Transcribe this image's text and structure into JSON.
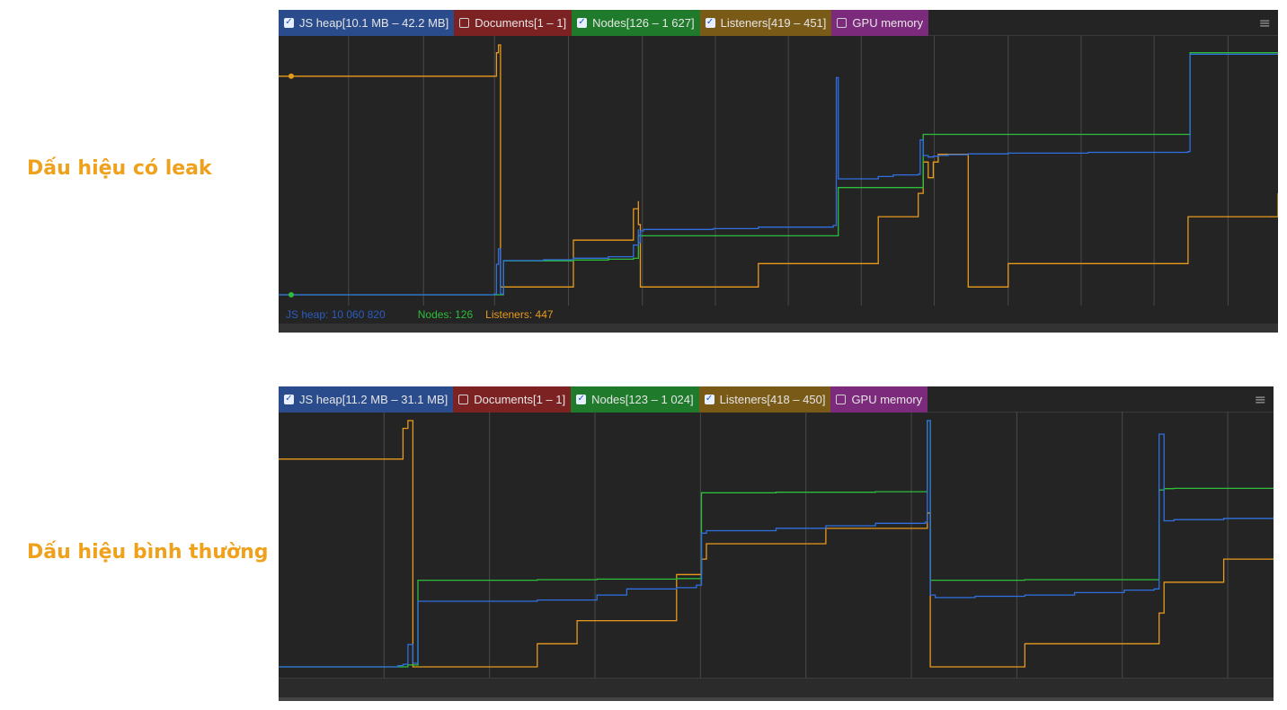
{
  "labels": {
    "leak": "Dấu hiệu có leak",
    "normal": "Dấu hiệu bình thường"
  },
  "colors": {
    "js_heap": "#2f6fe0",
    "nodes": "#2dbd3a",
    "listeners": "#e89a1c",
    "grid": "#4a4a4a",
    "label": "#f0a11c"
  },
  "panels": [
    {
      "legend": {
        "js_heap": "JS heap[10.1 MB – 42.2 MB]",
        "documents": "Documents[1 – 1]",
        "nodes": "Nodes[126 – 1 627]",
        "listeners": "Listeners[419 – 451]",
        "gpu": "GPU memory"
      },
      "checked": {
        "js_heap": true,
        "documents": false,
        "nodes": true,
        "listeners": true,
        "gpu": false
      },
      "status": {
        "js_heap": "JS heap: 10 060 820",
        "nodes": "Nodes: 126",
        "listeners": "Listeners: 447"
      }
    },
    {
      "legend": {
        "js_heap": "JS heap[11.2 MB – 31.1 MB]",
        "documents": "Documents[1 – 1]",
        "nodes": "Nodes[123 – 1 024]",
        "listeners": "Listeners[418 – 450]",
        "gpu": "GPU memory"
      },
      "checked": {
        "js_heap": true,
        "documents": false,
        "nodes": true,
        "listeners": true,
        "gpu": false
      }
    }
  ],
  "chart_data": [
    {
      "type": "line",
      "title": "Dấu hiệu có leak",
      "x": [
        0.0,
        0.216,
        0.218,
        0.22,
        0.222,
        0.225,
        0.265,
        0.295,
        0.33,
        0.355,
        0.36,
        0.36,
        0.362,
        0.365,
        0.435,
        0.48,
        0.555,
        0.558,
        0.56,
        0.6,
        0.615,
        0.64,
        0.642,
        0.645,
        0.65,
        0.655,
        0.66,
        0.67,
        0.69,
        0.7,
        0.73,
        0.8,
        0.81,
        0.85,
        0.91,
        0.912,
        0.915,
        1.0
      ],
      "series": [
        {
          "name": "JS heap",
          "range": [
            10.1,
            42.2
          ],
          "unit": "MB",
          "values": [
            10.1,
            10.2,
            14.0,
            16.0,
            10.2,
            14.5,
            14.6,
            14.8,
            15.0,
            16.5,
            18.5,
            16.8,
            18.3,
            18.5,
            18.6,
            18.8,
            19.0,
            38.0,
            25.0,
            25.3,
            25.5,
            25.6,
            30.0,
            28.0,
            27.8,
            27.9,
            28.0,
            28.1,
            28.2,
            28.2,
            28.3,
            28.3,
            28.4,
            28.4,
            28.5,
            41.0,
            41.0,
            41.2
          ]
        },
        {
          "name": "Nodes",
          "range": [
            126,
            1627
          ],
          "unit": "",
          "values": [
            126,
            126,
            126,
            126,
            126,
            330,
            330,
            335,
            340,
            345,
            480,
            480,
            480,
            480,
            480,
            480,
            480,
            480,
            770,
            770,
            770,
            770,
            770,
            1090,
            1090,
            1090,
            1090,
            1090,
            1090,
            1090,
            1090,
            1090,
            1090,
            1090,
            1090,
            1580,
            1580,
            1580
          ]
        },
        {
          "name": "Listeners",
          "range": [
            419,
            451
          ],
          "unit": "",
          "values": [
            447,
            447,
            450,
            451,
            420,
            420,
            420,
            426,
            426,
            430,
            431,
            428,
            420,
            420,
            420,
            423,
            423,
            423,
            423,
            429,
            429,
            432,
            432,
            436,
            434,
            436,
            437,
            437,
            420,
            420,
            423,
            423,
            423,
            423,
            429,
            429,
            429,
            432
          ]
        }
      ]
    },
    {
      "type": "line",
      "title": "Dấu hiệu bình thường",
      "x": [
        0.0,
        0.12,
        0.125,
        0.13,
        0.135,
        0.14,
        0.15,
        0.2,
        0.26,
        0.3,
        0.32,
        0.35,
        0.4,
        0.42,
        0.425,
        0.43,
        0.5,
        0.55,
        0.6,
        0.65,
        0.652,
        0.655,
        0.66,
        0.7,
        0.75,
        0.8,
        0.85,
        0.88,
        0.885,
        0.89,
        0.9,
        0.95,
        1.0
      ],
      "series": [
        {
          "name": "JS heap",
          "range": [
            11.2,
            31.1
          ],
          "unit": "MB",
          "values": [
            11.2,
            11.3,
            11.4,
            13.0,
            11.5,
            16.5,
            16.5,
            16.5,
            16.6,
            16.6,
            17.0,
            17.5,
            17.6,
            17.8,
            22.0,
            22.2,
            22.4,
            22.6,
            22.8,
            22.9,
            31.1,
            17.0,
            16.8,
            16.9,
            17.0,
            17.2,
            17.4,
            17.5,
            30.0,
            23.0,
            23.1,
            23.2,
            23.3
          ]
        },
        {
          "name": "Nodes",
          "range": [
            123,
            1024
          ],
          "unit": "",
          "values": [
            123,
            123,
            123,
            130,
            130,
            440,
            440,
            440,
            442,
            442,
            444,
            444,
            446,
            446,
            760,
            760,
            762,
            762,
            764,
            764,
            1024,
            440,
            440,
            440,
            442,
            442,
            442,
            442,
            770,
            775,
            776,
            776,
            776
          ]
        },
        {
          "name": "Listeners",
          "range": [
            418,
            450
          ],
          "unit": "",
          "values": [
            445,
            445,
            449,
            450,
            418,
            418,
            418,
            418,
            421,
            424,
            424,
            424,
            430,
            430,
            432,
            434,
            434,
            436,
            436,
            436,
            438,
            418,
            418,
            418,
            421,
            421,
            421,
            421,
            425,
            429,
            429,
            432,
            432
          ]
        }
      ]
    }
  ]
}
